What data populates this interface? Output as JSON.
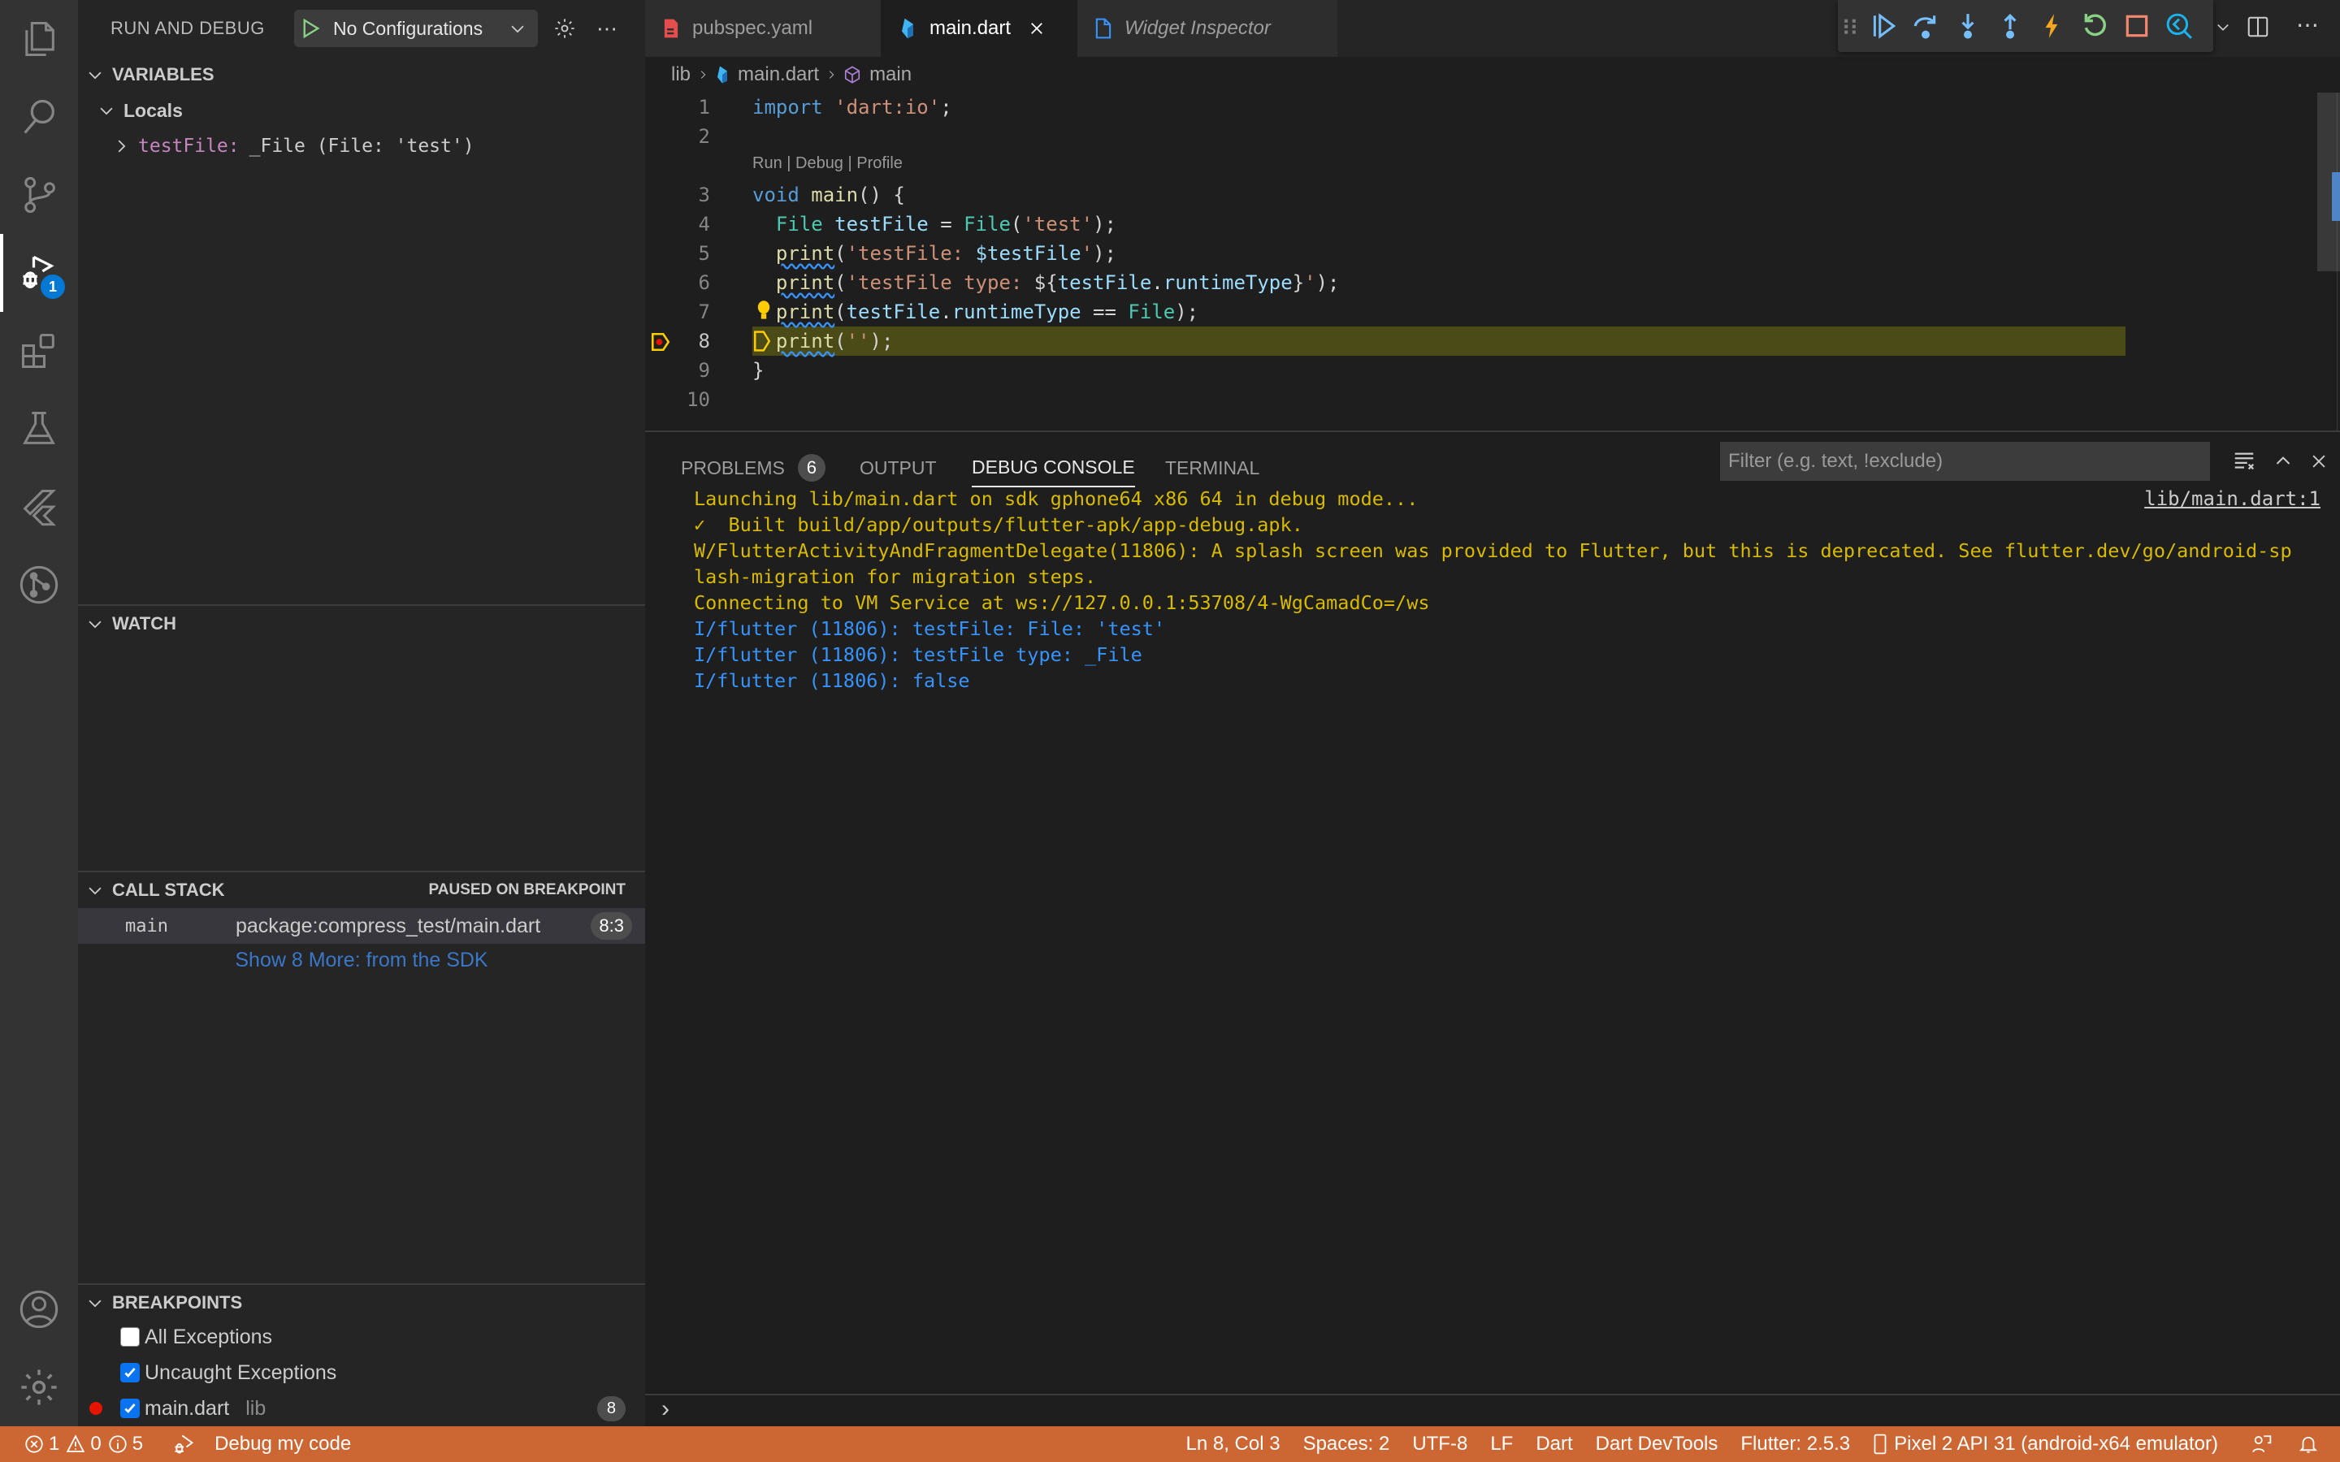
{
  "activity_bar": {
    "items": [
      {
        "id": "explorer",
        "icon": "files-icon"
      },
      {
        "id": "search",
        "icon": "search-icon"
      },
      {
        "id": "source-control",
        "icon": "source-control-icon"
      },
      {
        "id": "run-debug",
        "icon": "debug-icon",
        "badge": "1",
        "active": true
      },
      {
        "id": "extensions",
        "icon": "extensions-icon"
      },
      {
        "id": "testing",
        "icon": "flask-icon"
      },
      {
        "id": "flutter",
        "icon": "flutter-icon"
      },
      {
        "id": "git-graph",
        "icon": "git-graph-icon"
      }
    ],
    "bottom": [
      {
        "id": "accounts",
        "icon": "account-icon"
      },
      {
        "id": "manage",
        "icon": "gear-icon"
      }
    ]
  },
  "sidebar": {
    "title": "RUN AND DEBUG",
    "config_label": "No Configurations",
    "variables": {
      "header": "VARIABLES",
      "scope": "Locals",
      "items": [
        {
          "name": "testFile:",
          "value": "_File (File: 'test')"
        }
      ]
    },
    "watch": {
      "header": "WATCH"
    },
    "call_stack": {
      "header": "CALL STACK",
      "status": "PAUSED ON BREAKPOINT",
      "frames": [
        {
          "name": "main",
          "source": "package:compress_test/main.dart",
          "position": "8:3"
        }
      ],
      "show_more": "Show 8 More: from the SDK"
    },
    "breakpoints": {
      "header": "BREAKPOINTS",
      "items": [
        {
          "label": "All Exceptions",
          "checked": false
        },
        {
          "label": "Uncaught Exceptions",
          "checked": true
        },
        {
          "label": "main.dart",
          "sub": "lib",
          "checked": true,
          "line": "8"
        }
      ]
    }
  },
  "tabs": [
    {
      "label": "pubspec.yaml",
      "icon": "yaml-file-icon",
      "active": false
    },
    {
      "label": "main.dart",
      "icon": "dart-file-icon",
      "active": true
    },
    {
      "label": "Widget Inspector",
      "icon": "file-icon",
      "active": false,
      "italic": true
    }
  ],
  "debug_toolbar": [
    "drag-handle",
    "continue",
    "step-over",
    "step-into",
    "step-out",
    "hot-reload",
    "hot-restart",
    "stop",
    "flutter-inspector"
  ],
  "breadcrumb": [
    "lib",
    "main.dart",
    "main"
  ],
  "editor": {
    "codelens": "Run | Debug | Profile",
    "current_line": 8,
    "lines": [
      {
        "n": "1",
        "text": "import 'dart:io';"
      },
      {
        "n": "2",
        "text": ""
      },
      {
        "n": "3",
        "text": "void main() {"
      },
      {
        "n": "4",
        "text": "  File testFile = File('test');"
      },
      {
        "n": "5",
        "text": "  print('testFile: $testFile');"
      },
      {
        "n": "6",
        "text": "  print('testFile type: ${testFile.runtimeType}');"
      },
      {
        "n": "7",
        "text": "  print(testFile.runtimeType == File);"
      },
      {
        "n": "8",
        "text": "  print('');"
      },
      {
        "n": "9",
        "text": "}"
      },
      {
        "n": "10",
        "text": ""
      }
    ]
  },
  "panel": {
    "tabs": [
      {
        "label": "PROBLEMS",
        "badge": "6"
      },
      {
        "label": "OUTPUT"
      },
      {
        "label": "DEBUG CONSOLE",
        "active": true
      },
      {
        "label": "TERMINAL"
      }
    ],
    "filter_placeholder": "Filter (e.g. text, !exclude)",
    "source_link": "lib/main.dart:1",
    "console": [
      {
        "text": "Launching lib/main.dart on sdk gphone64 x86 64 in debug mode...",
        "color": "yellow"
      },
      {
        "text": "✓  Built build/app/outputs/flutter-apk/app-debug.apk.",
        "color": "yellow"
      },
      {
        "text": "W/FlutterActivityAndFragmentDelegate(11806): A splash screen was provided to Flutter, but this is deprecated. See flutter.dev/go/android-sp",
        "color": "yellow"
      },
      {
        "text": "lash-migration for migration steps.",
        "color": "yellow"
      },
      {
        "text": "Connecting to VM Service at ws://127.0.0.1:53708/4-WgCamadCo=/ws",
        "color": "yellow"
      },
      {
        "text": "I/flutter (11806): testFile: File: 'test'",
        "color": "blue"
      },
      {
        "text": "I/flutter (11806): testFile type: _File",
        "color": "blue"
      },
      {
        "text": "I/flutter (11806): false",
        "color": "blue"
      }
    ],
    "repl_prompt": "›"
  },
  "statusbar": {
    "errors": "1",
    "warnings": "0",
    "infos": "5",
    "debug_label": "Debug my code",
    "position": "Ln 8, Col 3",
    "spaces": "Spaces: 2",
    "encoding": "UTF-8",
    "eol": "LF",
    "language": "Dart",
    "devtools": "Dart DevTools",
    "flutter": "Flutter: 2.5.3",
    "device": "Pixel 2 API 31 (android-x64 emulator)",
    "color": "#cc6633"
  }
}
